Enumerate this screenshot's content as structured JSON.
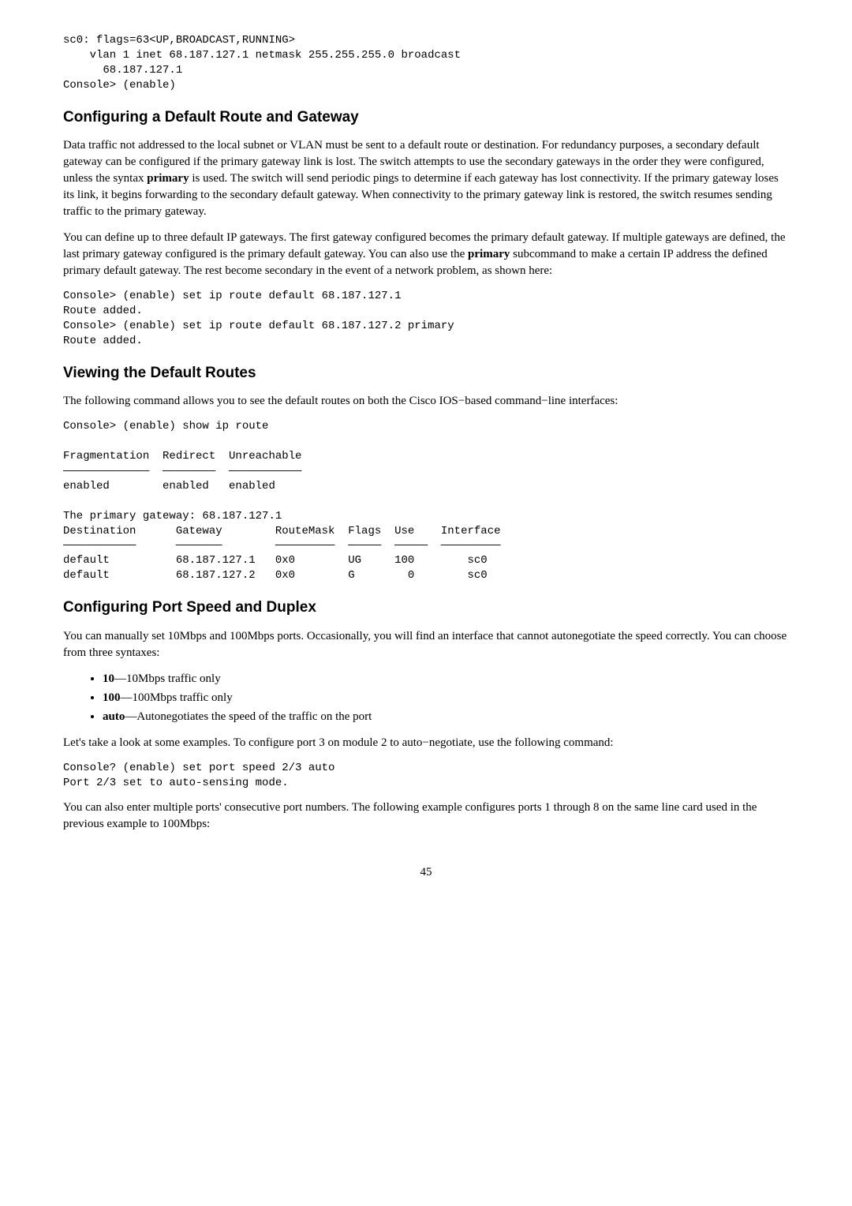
{
  "code1": "sc0: flags=63<UP,BROADCAST,RUNNING>\n    vlan 1 inet 68.187.127.1 netmask 255.255.255.0 broadcast\n      68.187.127.1\nConsole> (enable)",
  "h1": "Configuring a Default Route and Gateway",
  "p1a": "Data traffic not addressed to the local subnet or VLAN must be sent to a default route or destination. For redundancy purposes, a secondary default gateway can be configured if the primary gateway link is lost. The switch attempts to use the secondary gateways in the order they were configured, unless the syntax ",
  "p1b": "primary",
  "p1c": " is used. The switch will send periodic pings to determine if each gateway has lost connectivity. If the primary gateway loses its link, it begins forwarding to the secondary default gateway. When connectivity to the primary gateway link is restored, the switch resumes sending traffic to the primary gateway.",
  "p2a": "You can define up to three default IP gateways. The first gateway configured becomes the primary default gateway. If multiple gateways are defined, the last primary gateway configured is the primary default gateway. You can also use the ",
  "p2b": "primary",
  "p2c": " subcommand to make a certain IP address the defined primary default gateway. The rest become secondary in the event of a network problem, as shown here:",
  "code2": "Console> (enable) set ip route default 68.187.127.1\nRoute added.\nConsole> (enable) set ip route default 68.187.127.2 primary\nRoute added.",
  "h2": "Viewing the Default Routes",
  "p3": "The following command allows you to see the default routes on both the Cisco IOS−based command−line interfaces:",
  "code3": "Console> (enable) show ip route\n\nFragmentation  Redirect  Unreachable\n—————————————  ————————  ———————————\nenabled        enabled   enabled\n\nThe primary gateway: 68.187.127.1\nDestination      Gateway        RouteMask  Flags  Use    Interface\n———————————      ———————        —————————  —————  —————  —————————\ndefault          68.187.127.1   0x0        UG     100        sc0\ndefault          68.187.127.2   0x0        G        0        sc0",
  "h3": "Configuring Port Speed and Duplex",
  "p4": "You can manually set 10Mbps and 100Mbps ports. Occasionally, you will find an interface that cannot autonegotiate the speed correctly. You can choose from three syntaxes:",
  "b1a": "10",
  "b1b": "—10Mbps traffic only",
  "b2a": "100",
  "b2b": "—100Mbps traffic only",
  "b3a": "auto",
  "b3b": "—Autonegotiates the speed of the traffic on the port",
  "p5": "Let's take a look at some examples. To configure port 3 on module 2 to auto−negotiate, use the following command:",
  "code4": "Console? (enable) set port speed 2/3 auto\nPort 2/3 set to auto-sensing mode.",
  "p6": "You can also enter multiple ports' consecutive port numbers. The following example configures ports 1 through 8 on the same line card used in the previous example to 100Mbps:",
  "pagenum": "45"
}
